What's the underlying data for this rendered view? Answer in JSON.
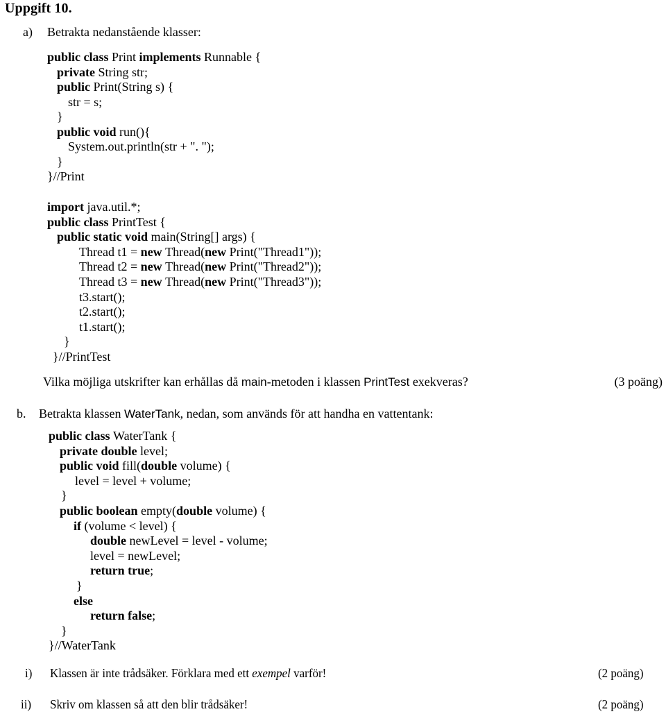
{
  "document": {
    "title": "Uppgift 10."
  },
  "part_a": {
    "marker": "a)",
    "prompt": "Betrakta nedanstående klasser:",
    "code_print": [
      {
        "indent": 68,
        "segments": [
          {
            "t": "public class ",
            "b": true
          },
          {
            "t": "Print ",
            "b": false
          },
          {
            "t": "implements ",
            "b": true
          },
          {
            "t": "Runnable {",
            "b": false
          }
        ]
      },
      {
        "indent": 82,
        "segments": [
          {
            "t": "private ",
            "b": true
          },
          {
            "t": "String str;",
            "b": false
          }
        ]
      },
      {
        "indent": 82,
        "segments": [
          {
            "t": "public ",
            "b": true
          },
          {
            "t": "Print(String s) {",
            "b": false
          }
        ]
      },
      {
        "indent": 98,
        "segments": [
          {
            "t": "str = s;",
            "b": false
          }
        ]
      },
      {
        "indent": 82,
        "segments": [
          {
            "t": "}",
            "b": false
          }
        ]
      },
      {
        "indent": 82,
        "segments": [
          {
            "t": "public void ",
            "b": true
          },
          {
            "t": "run(){",
            "b": false
          }
        ]
      },
      {
        "indent": 98,
        "segments": [
          {
            "t": "System.out.println(str + \". \");",
            "b": false
          }
        ]
      },
      {
        "indent": 82,
        "segments": [
          {
            "t": "}",
            "b": false
          }
        ]
      },
      {
        "indent": 68,
        "segments": [
          {
            "t": "}//Print",
            "b": false
          }
        ]
      }
    ],
    "code_printtest": [
      {
        "indent": 68,
        "segments": [
          {
            "t": "import ",
            "b": true
          },
          {
            "t": "java.util.*;",
            "b": false
          }
        ]
      },
      {
        "indent": 68,
        "segments": [
          {
            "t": "public class ",
            "b": true
          },
          {
            "t": "PrintTest {",
            "b": false
          }
        ]
      },
      {
        "indent": 82,
        "segments": [
          {
            "t": "public static void ",
            "b": true
          },
          {
            "t": "main(String[] args) {",
            "b": false
          }
        ]
      },
      {
        "indent": 114,
        "segments": [
          {
            "t": "Thread t1 = ",
            "b": false
          },
          {
            "t": "new ",
            "b": true
          },
          {
            "t": "Thread(",
            "b": false
          },
          {
            "t": "new ",
            "b": true
          },
          {
            "t": "Print(\"Thread1\"));",
            "b": false
          }
        ]
      },
      {
        "indent": 114,
        "segments": [
          {
            "t": "Thread t2 = ",
            "b": false
          },
          {
            "t": "new ",
            "b": true
          },
          {
            "t": "Thread(",
            "b": false
          },
          {
            "t": "new ",
            "b": true
          },
          {
            "t": "Print(\"Thread2\"));",
            "b": false
          }
        ]
      },
      {
        "indent": 114,
        "segments": [
          {
            "t": "Thread t3 = ",
            "b": false
          },
          {
            "t": "new ",
            "b": true
          },
          {
            "t": "Thread(",
            "b": false
          },
          {
            "t": "new ",
            "b": true
          },
          {
            "t": "Print(\"Thread3\"));",
            "b": false
          }
        ]
      },
      {
        "indent": 114,
        "segments": [
          {
            "t": "t3.start();",
            "b": false
          }
        ]
      },
      {
        "indent": 114,
        "segments": [
          {
            "t": "t2.start();",
            "b": false
          }
        ]
      },
      {
        "indent": 114,
        "segments": [
          {
            "t": "t1.start();",
            "b": false
          }
        ]
      },
      {
        "indent": 92,
        "segments": [
          {
            "t": "}",
            "b": false
          }
        ]
      },
      {
        "indent": 76,
        "segments": [
          {
            "t": "}//PrintTest",
            "b": false
          }
        ]
      }
    ],
    "question_part1": "Vilka möjliga utskrifter kan erhållas då ",
    "question_mono1": "main",
    "question_part2": "-metoden i klassen ",
    "question_mono2": "PrintTest",
    "question_part3": " exekveras?",
    "points": "(3 poäng)"
  },
  "part_b": {
    "marker": "b.",
    "prompt_part1": "Betrakta klassen ",
    "prompt_mono": "WaterTank",
    "prompt_part2": ", nedan, som används för att handha en vattentank:",
    "code_watertank": [
      {
        "indent": 70,
        "segments": [
          {
            "t": "public class ",
            "b": true
          },
          {
            "t": "WaterTank {",
            "b": false
          }
        ]
      },
      {
        "indent": 86,
        "segments": [
          {
            "t": "private double ",
            "b": true
          },
          {
            "t": "level;",
            "b": false
          }
        ]
      },
      {
        "indent": 86,
        "segments": [
          {
            "t": "public void ",
            "b": true
          },
          {
            "t": "fill(",
            "b": false
          },
          {
            "t": "double ",
            "b": true
          },
          {
            "t": "volume) {",
            "b": false
          }
        ]
      },
      {
        "indent": 108,
        "segments": [
          {
            "t": "level = level + volume;",
            "b": false
          }
        ]
      },
      {
        "indent": 88,
        "segments": [
          {
            "t": "}",
            "b": false
          }
        ]
      },
      {
        "indent": 86,
        "segments": [
          {
            "t": "public boolean ",
            "b": true
          },
          {
            "t": "empty(",
            "b": false
          },
          {
            "t": "double ",
            "b": true
          },
          {
            "t": "volume) {",
            "b": false
          }
        ]
      },
      {
        "indent": 106,
        "segments": [
          {
            "t": "if ",
            "b": true
          },
          {
            "t": "(volume < level) {",
            "b": false
          }
        ]
      },
      {
        "indent": 130,
        "segments": [
          {
            "t": "double ",
            "b": true
          },
          {
            "t": "newLevel = level - volume;",
            "b": false
          }
        ]
      },
      {
        "indent": 130,
        "segments": [
          {
            "t": "level = newLevel;",
            "b": false
          }
        ]
      },
      {
        "indent": 130,
        "segments": [
          {
            "t": "return true",
            "b": true
          },
          {
            "t": ";",
            "b": false
          }
        ]
      },
      {
        "indent": 110,
        "segments": [
          {
            "t": "}",
            "b": false
          }
        ]
      },
      {
        "indent": 106,
        "segments": [
          {
            "t": "else",
            "b": true
          }
        ]
      },
      {
        "indent": 130,
        "segments": [
          {
            "t": "return false",
            "b": true
          },
          {
            "t": ";",
            "b": false
          }
        ]
      },
      {
        "indent": 88,
        "segments": [
          {
            "t": "}",
            "b": false
          }
        ]
      },
      {
        "indent": 70,
        "segments": [
          {
            "t": "}//WaterTank",
            "b": false
          }
        ]
      }
    ],
    "sub_items": [
      {
        "marker": "i)",
        "text_part1": "Klassen är inte trådsäker. Förklara med ett ",
        "text_italic": "exempel",
        "text_part2": " varför!",
        "points": "(2 poäng)"
      },
      {
        "marker": "ii)",
        "text_part1": "Skriv om klassen så att den blir trådsäker!",
        "text_italic": "",
        "text_part2": "",
        "points": "(2 poäng)"
      }
    ]
  }
}
